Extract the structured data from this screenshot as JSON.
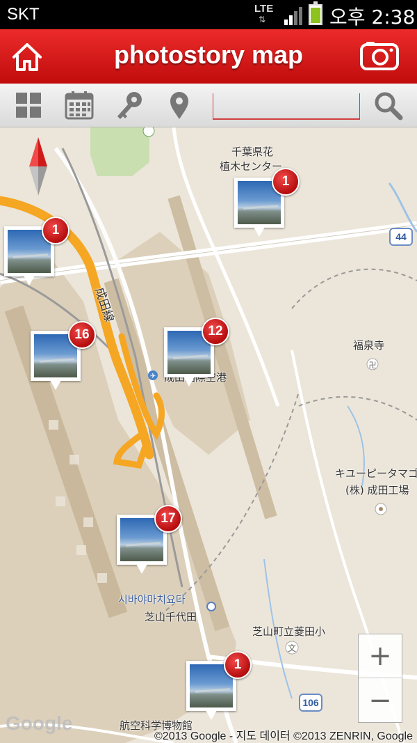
{
  "status_bar": {
    "carrier": "SKT",
    "network": "LTE",
    "time": "오후 2:38"
  },
  "app_bar": {
    "title": "photostory map"
  },
  "toolbar": {
    "search_value": ""
  },
  "map": {
    "labels": {
      "flower_center_line1": "千葉県花",
      "flower_center_line2": "植木センター",
      "narita_line": "成田線",
      "fukusenji": "福泉寺",
      "airport": "成田国際空港",
      "kewpie_line1": "キユーピータマゴ",
      "kewpie_line2": "(株) 成田工場",
      "shibayama_kr": "시바야마치요다",
      "shibayama_jp": "芝山千代田",
      "school": "芝山町立菱田小",
      "museum": "航空科学博物館"
    },
    "route_44": "44",
    "route_106": "106",
    "markers": [
      {
        "count": "1"
      },
      {
        "count": "1"
      },
      {
        "count": "16"
      },
      {
        "count": "12"
      },
      {
        "count": "17"
      },
      {
        "count": "1"
      }
    ],
    "zoom_in": "+",
    "zoom_out": "−",
    "google_logo": "Google",
    "attribution": "©2013 Google - 지도 데이터 ©2013 ZENRIN, Google"
  },
  "colors": {
    "accent": "#d81818",
    "route_highlight": "#f5a623",
    "badge": "#c81414"
  }
}
